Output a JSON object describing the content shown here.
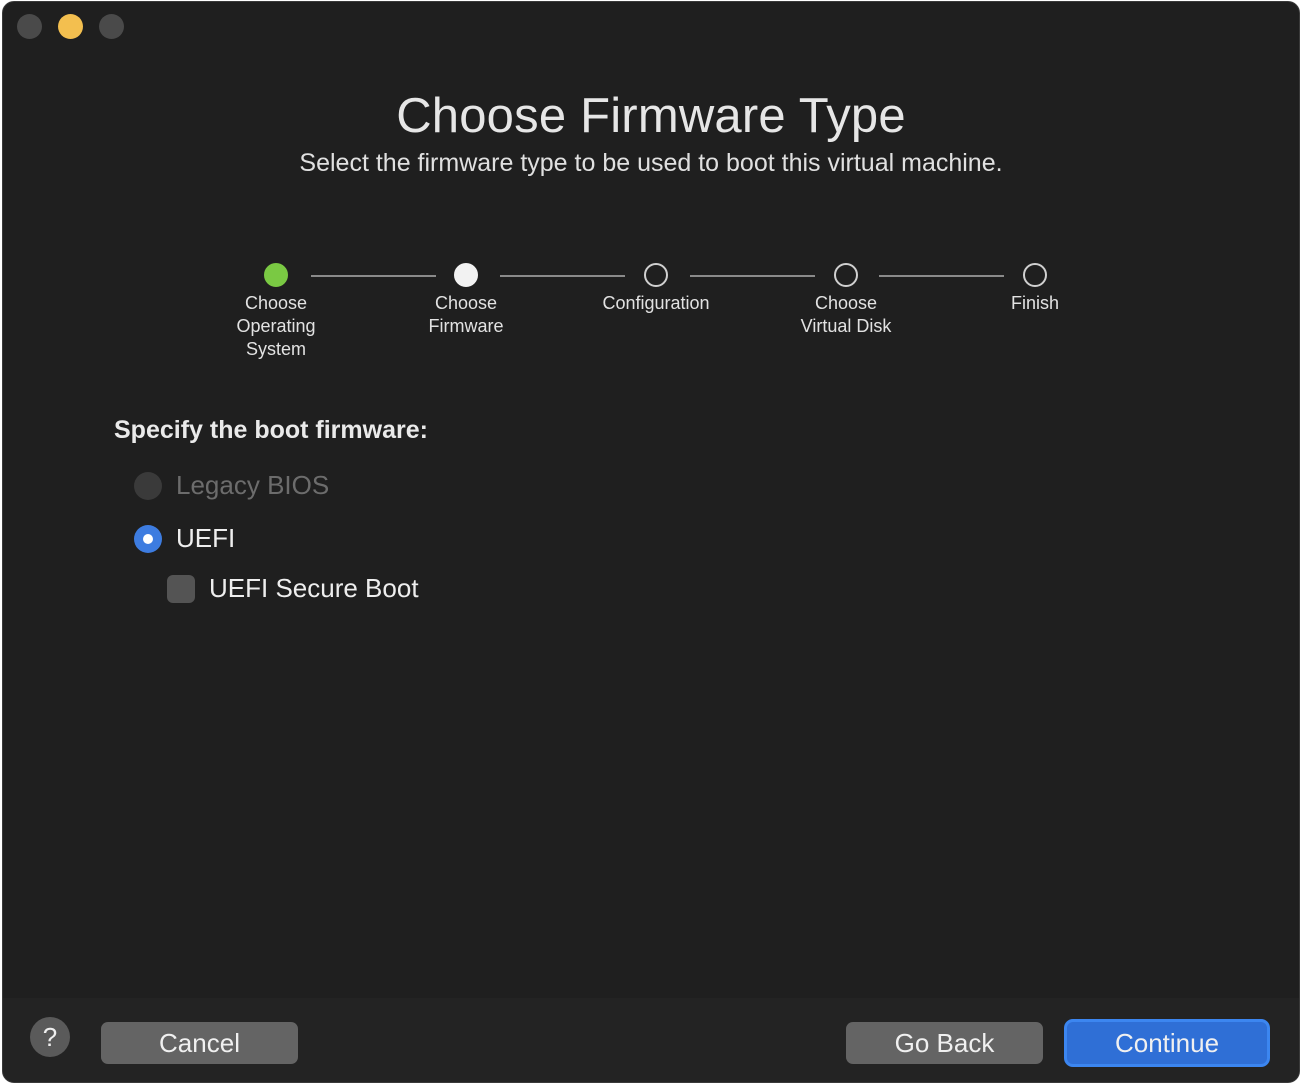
{
  "window": {
    "title": "Choose Firmware Type",
    "subtitle": "Select the firmware type to be used to boot this virtual machine."
  },
  "stepper": {
    "steps": [
      {
        "label": "Choose\nOperating\nSystem",
        "state": "done"
      },
      {
        "label": "Choose\nFirmware",
        "state": "current"
      },
      {
        "label": "Configuration",
        "state": "pending"
      },
      {
        "label": "Choose\nVirtual Disk",
        "state": "pending"
      },
      {
        "label": "Finish",
        "state": "pending"
      }
    ]
  },
  "firmware": {
    "heading": "Specify the boot firmware:",
    "options": [
      {
        "label": "Legacy BIOS",
        "selected": false,
        "enabled": false
      },
      {
        "label": "UEFI",
        "selected": true,
        "enabled": true
      }
    ],
    "secure_boot": {
      "label": "UEFI Secure Boot",
      "checked": false
    }
  },
  "footer": {
    "help_label": "?",
    "cancel_label": "Cancel",
    "back_label": "Go Back",
    "continue_label": "Continue"
  },
  "colors": {
    "accent": "#2f6fd6",
    "step_done": "#7ac943",
    "minimize": "#f3bf4f"
  }
}
